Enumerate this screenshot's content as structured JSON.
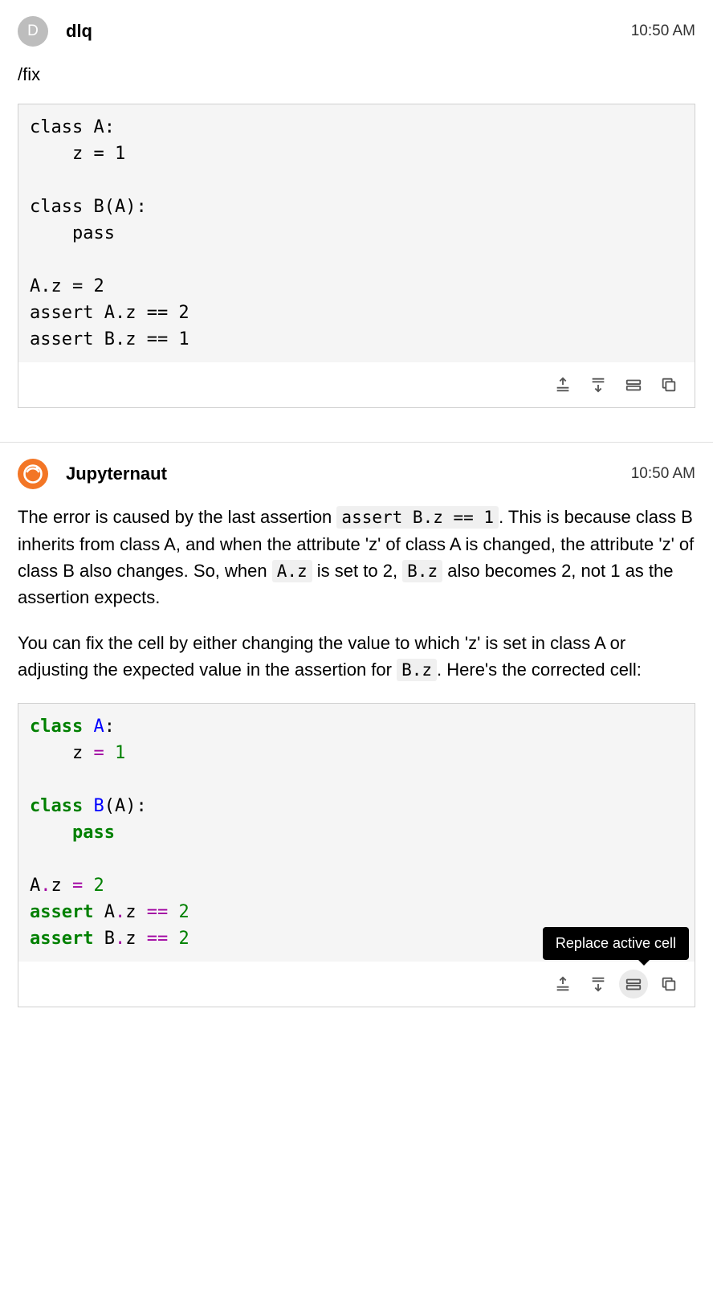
{
  "messages": [
    {
      "avatar_letter": "D",
      "username": "dlq",
      "timestamp": "10:50 AM",
      "command": "/fix",
      "code_plain": "class A:\n    z = 1\n\nclass B(A):\n    pass\n\nA.z = 2\nassert A.z == 2\nassert B.z == 1"
    },
    {
      "username": "Jupyternaut",
      "timestamp": "10:50 AM",
      "text_parts": {
        "p1_a": "The error is caused by the last assertion ",
        "p1_code1": "assert B.z == 1",
        "p1_b": ". This is because class B inherits from class A, and when the attribute 'z' of class A is changed, the attribute 'z' of class B also changes. So, when ",
        "p1_code2": "A.z",
        "p1_c": " is set to 2, ",
        "p1_code3": "B.z",
        "p1_d": " also becomes 2, not 1 as the assertion expects.",
        "p2_a": "You can fix the cell by either changing the value to which 'z' is set in class A or adjusting the expected value in the assertion for ",
        "p2_code1": "B.z",
        "p2_b": ". Here's the corrected cell:"
      },
      "code_tokens": {
        "class1": "class",
        "A": "A",
        "colon": ":",
        "z": "z",
        "eq": "=",
        "n1": "1",
        "class2": "class",
        "B": "B",
        "lparen": "(",
        "A2": "A",
        "rparen": ")",
        "pass": "pass",
        "Az": "A",
        "dot": ".",
        "z2": "z",
        "n2": "2",
        "assert1": "assert",
        "eqeq": "==",
        "assert2": "assert",
        "n2b": "2",
        "n2c": "2"
      },
      "tooltip": "Replace active cell"
    }
  ],
  "toolbar_icons": {
    "insert_above": "insert-above-icon",
    "insert_below": "insert-below-icon",
    "replace_cell": "replace-cell-icon",
    "copy": "copy-icon"
  }
}
